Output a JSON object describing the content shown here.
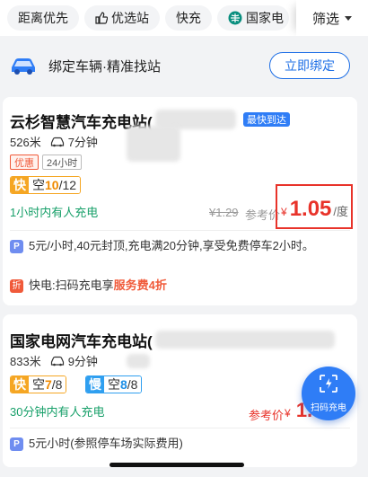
{
  "filters": {
    "chips": [
      "距离优先",
      "优选站",
      "快充",
      "国家电"
    ],
    "filter_label": "筛选"
  },
  "bind": {
    "text": "绑定车辆·精准找站",
    "button": "立即绑定"
  },
  "stations": [
    {
      "name": "云杉智慧汽车充电站(",
      "fast_tag": "最快到达",
      "distance": "526米",
      "drive_time": "7分钟",
      "promo_tag": "优惠",
      "hours_tag": "24小时",
      "fast_key": "快",
      "fast_free_label": "空",
      "fast_free": "10",
      "fast_total": "/12",
      "attended": "1小时内有人充电",
      "orig_price": "¥1.29",
      "ref_label": "参考价",
      "price_symbol": "¥",
      "price": "1.05",
      "price_unit": "/度",
      "parking": "5元/小时,40元封顶,充电满20分钟,享受免费停车2小时。",
      "discount_prefix": "快电:扫码充电享",
      "discount_highlight": "服务费4折"
    },
    {
      "name": "国家电网汽车充电站(",
      "distance": "833米",
      "drive_time": "9分钟",
      "fast_key": "快",
      "fast_free_label": "空",
      "fast_free": "7",
      "fast_total": "/8",
      "slow_key": "慢",
      "slow_free_label": "空",
      "slow_free": "8",
      "slow_total": "/8",
      "attended": "30分钟内有人充电",
      "ref_label": "参考价",
      "price_symbol": "¥",
      "price": "1.0",
      "parking": "5元小时(参照停车场实际费用)"
    }
  ],
  "scan": {
    "label": "扫码充电"
  },
  "colors": {
    "accent": "#2f7df6",
    "price": "#e8332a",
    "attended": "#18a06a",
    "fast": "#f5a623",
    "slow": "#2f9ff0"
  }
}
